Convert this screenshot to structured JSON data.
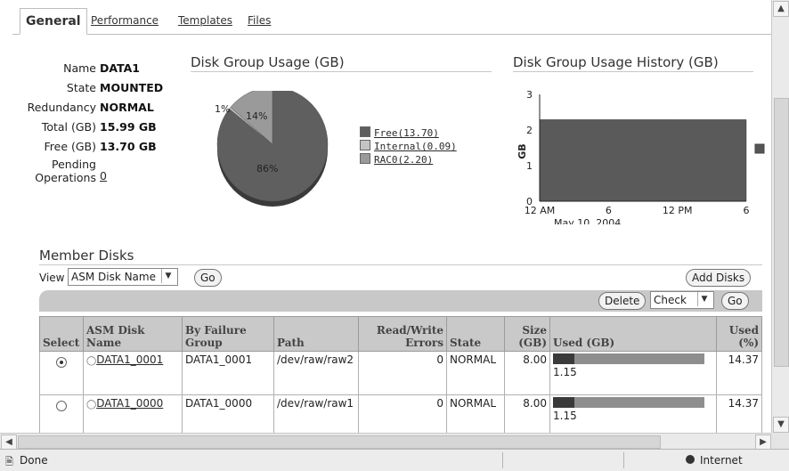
{
  "tabs": {
    "active": "General",
    "items": [
      "Performance",
      "Templates",
      "Files"
    ]
  },
  "info": {
    "name_label": "Name",
    "name_value": "DATA1",
    "state_label": "State",
    "state_value": "MOUNTED",
    "redundancy_label": "Redundancy",
    "redundancy_value": "NORMAL",
    "total_label": "Total (GB)",
    "total_value": "15.99 GB",
    "free_label": "Free (GB)",
    "free_value": "13.70 GB",
    "pending_label_1": "Pending",
    "pending_label_2": "Operations",
    "pending_value": "0"
  },
  "usage": {
    "title": "Disk Group Usage (GB)",
    "slices": [
      {
        "name": "Free",
        "value": 13.7,
        "pct_label": "86%",
        "color": "#5f5f5f"
      },
      {
        "name": "Internal",
        "value": 0.09,
        "pct_label": "1%",
        "color": "#c4c4c4"
      },
      {
        "name": "RAC0",
        "value": 2.2,
        "pct_label": "14%",
        "color": "#9a9a9a"
      }
    ],
    "legend": [
      "Free(13.70)",
      "Internal(0.09)",
      "RAC0(2.20)"
    ]
  },
  "history": {
    "title": "Disk Group Usage History (GB)",
    "y_label": "GB",
    "y_ticks": [
      "0",
      "1",
      "2",
      "3"
    ],
    "x_ticks": [
      "12 AM",
      "6",
      "12 PM",
      "6"
    ],
    "date": "May 10, 2004",
    "chart_data": {
      "type": "area",
      "x": [
        "12 AM",
        "6",
        "12 PM",
        "6"
      ],
      "series": [
        {
          "values": [
            2.29,
            2.29,
            2.29,
            2.29
          ]
        }
      ],
      "ylim": [
        0,
        3
      ]
    }
  },
  "members": {
    "title": "Member Disks",
    "view_label": "View",
    "view_select": "ASM Disk Name",
    "go": "Go",
    "add_disks": "Add Disks",
    "delete": "Delete",
    "action_select": "Check",
    "columns": {
      "select": "Select",
      "asm_disk_1": "ASM Disk",
      "asm_disk_2": "Name",
      "failure_1": "By Failure",
      "failure_2": "Group",
      "path": "Path",
      "rw_1": "Read/Write",
      "rw_2": "Errors",
      "state": "State",
      "size_1": "Size",
      "size_2": "(GB)",
      "used_gb": "Used (GB)",
      "used_pct_1": "Used",
      "used_pct_2": "(%)"
    },
    "rows": [
      {
        "name": "DATA1_0001",
        "failure_group": "DATA1_0001",
        "path": "/dev/raw/raw2",
        "errors": "0",
        "state": "NORMAL",
        "size": "8.00",
        "used_gb": "1.15",
        "used_fraction": 0.1437,
        "used_pct": "14.37",
        "selected": true
      },
      {
        "name": "DATA1_0000",
        "failure_group": "DATA1_0000",
        "path": "/dev/raw/raw1",
        "errors": "0",
        "state": "NORMAL",
        "size": "8.00",
        "used_gb": "1.15",
        "used_fraction": 0.1437,
        "used_pct": "14.37",
        "selected": false
      }
    ]
  },
  "status_bar": {
    "left": "Done",
    "right": "Internet"
  }
}
